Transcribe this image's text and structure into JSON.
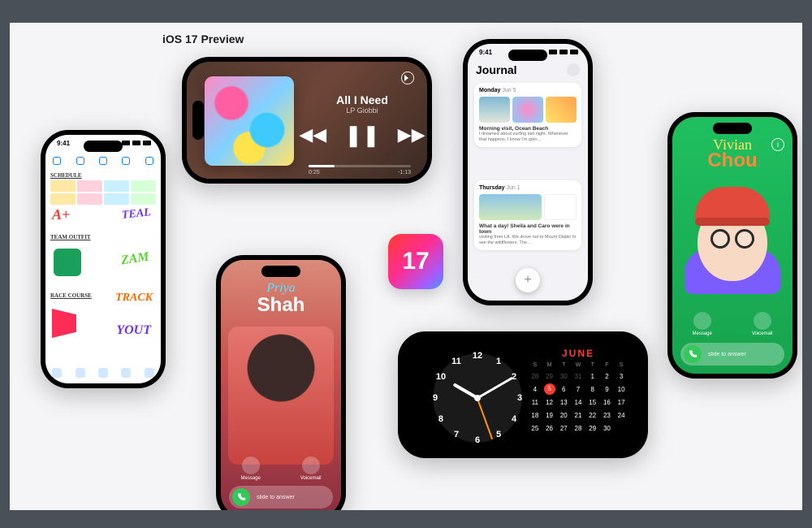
{
  "title": "iOS 17 Preview",
  "ios_logo": "17",
  "status_time": "9:41",
  "freeform": {
    "headings": [
      "SCHEDULE",
      "TEAM OUTFIT",
      "RACE COURSE"
    ],
    "stickers": {
      "aplus": "A+",
      "teal": "TEAL",
      "zam": "ZAM",
      "track": "TRACK",
      "yout": "YOUT"
    }
  },
  "music": {
    "title": "All I Need",
    "artist": "LP Giobbi",
    "elapsed": "0:25",
    "remaining": "-1:13"
  },
  "call1": {
    "first": "Priya",
    "last": "Shah",
    "message": "Message",
    "voicemail": "Voicemail",
    "answer": "slide to answer"
  },
  "journal": {
    "heading": "Journal",
    "e1": {
      "day": "Monday",
      "date": "Jun 5",
      "title": "Morning visit, Ocean Beach",
      "body": "I dreamed about surfing last night. Whenever that happens, I know I'm goin…"
    },
    "e2": {
      "day": "Thursday",
      "date": "Jun 1",
      "title": "What a day! Sheila and Caro were in town",
      "body": "visiting from LA. We drove out to Mount Diablo to see the wildflowers. The…"
    }
  },
  "standby": {
    "month": "JUNE",
    "dow": [
      "S",
      "M",
      "T",
      "W",
      "T",
      "F",
      "S"
    ],
    "lead_dim": [
      "28",
      "29",
      "30",
      "31"
    ],
    "days": [
      "1",
      "2",
      "3",
      "4",
      "5",
      "6",
      "7",
      "8",
      "9",
      "10",
      "11",
      "12",
      "13",
      "14",
      "15",
      "16",
      "17",
      "18",
      "19",
      "20",
      "21",
      "22",
      "23",
      "24",
      "25",
      "26",
      "27",
      "28",
      "29",
      "30"
    ],
    "today": "5",
    "clock_numbers": [
      "12",
      "1",
      "2",
      "3",
      "4",
      "5",
      "6",
      "7",
      "8",
      "9",
      "10",
      "11"
    ]
  },
  "call2": {
    "first": "Vivian",
    "last": "Chou",
    "message": "Message",
    "voicemail": "Voicemail",
    "answer": "slide to answer"
  }
}
